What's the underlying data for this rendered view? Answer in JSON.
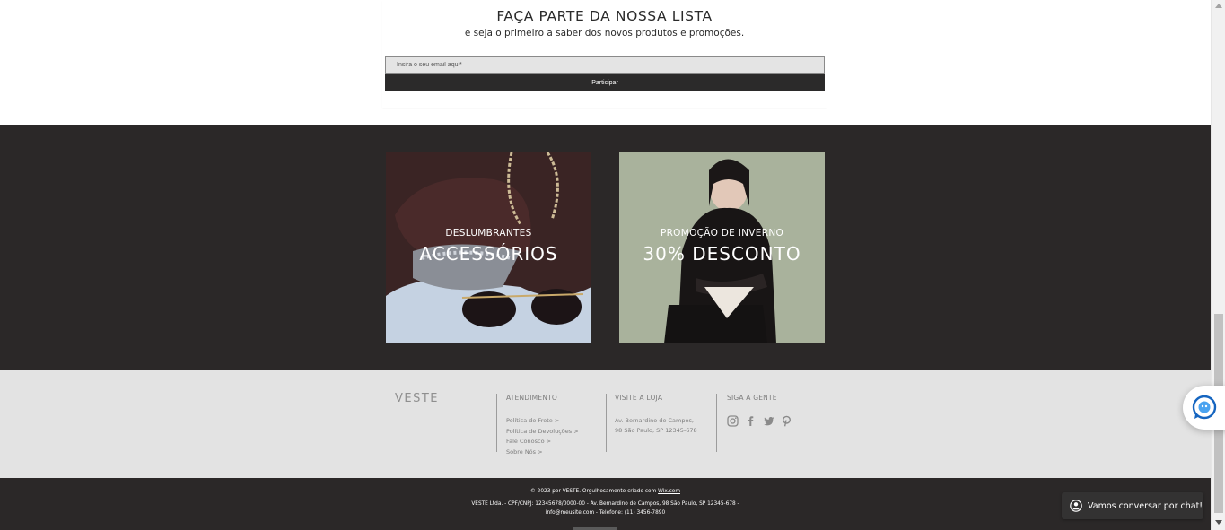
{
  "newsletter": {
    "title": "FAÇA PARTE DA NOSSA LISTA",
    "subtitle": "e seja o primeiro a saber dos novos produtos e promoções.",
    "email_placeholder": "Insira o seu email aqui*",
    "submit_label": "Participar"
  },
  "promos": [
    {
      "small": "DESLUMBRANTES",
      "big": "ACCESSÓRIOS"
    },
    {
      "small": "PROMOÇÃO DE INVERNO",
      "big": "30% DESCONTO"
    }
  ],
  "footer": {
    "brand": "VESTE",
    "atendimento": {
      "heading": "ATENDIMENTO",
      "links": [
        "Política de Frete >",
        "Política de Devoluções >",
        "Fale Conosco >",
        "Sobre Nós >"
      ]
    },
    "visite": {
      "heading": "VISITE A LOJA",
      "lines": [
        "Av. Bernardino de Campos,",
        "98 São Paulo, SP 12345-678"
      ]
    },
    "siga": {
      "heading": "SIGA A GENTE",
      "icons": [
        "instagram-icon",
        "facebook-icon",
        "twitter-icon",
        "pinterest-icon"
      ]
    }
  },
  "legal": {
    "line1_prefix": "© 2023 por VESTE. Orgulhosamente criado com ",
    "line1_link": "Wix.com",
    "line2": "VESTE Ltda. - CPF/CNPJ: 12345678/0000-00 - Av. Bernardino de Campos, 98 São Paulo, SP 12345-678 -",
    "line3": "info@meusite.com - Telefone: (11) 3456-7890"
  },
  "chat": {
    "label": "Vamos conversar por chat!"
  },
  "colors": {
    "dark_band": "#2b2828",
    "footer_gray": "#e3e3e3",
    "button_dark": "#2b2a2a"
  }
}
